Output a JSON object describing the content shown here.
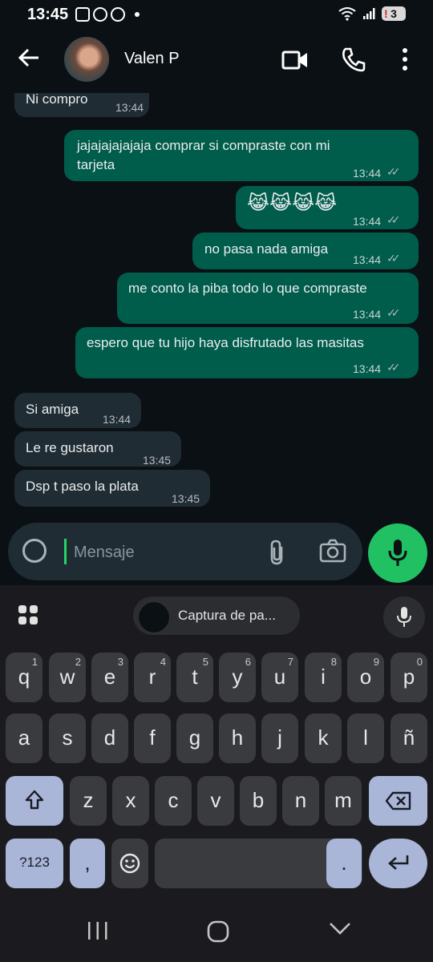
{
  "status_bar": {
    "time": "13:45",
    "notification_count": "3"
  },
  "header": {
    "contact_name": "Valen P"
  },
  "messages": [
    {
      "dir": "in",
      "text": "Ni compro",
      "time": "13:44"
    },
    {
      "dir": "out",
      "lines": [
        "jajajajajajaja comprar si compraste con mi",
        "tarjeta"
      ],
      "time": "13:44"
    },
    {
      "dir": "out",
      "text": "😹😹😹😹",
      "time": "13:44"
    },
    {
      "dir": "out",
      "text": "no pasa nada amiga",
      "time": "13:44"
    },
    {
      "dir": "out",
      "text": "me conto la piba todo lo que compraste",
      "time": "13:44"
    },
    {
      "dir": "out",
      "text": "espero que tu hijo haya disfrutado las masitas",
      "time": "13:44"
    },
    {
      "dir": "in",
      "text": "Si amiga",
      "time": "13:44"
    },
    {
      "dir": "in",
      "text": "Le re gustaron",
      "time": "13:45"
    },
    {
      "dir": "in",
      "text": "Dsp t paso la plata",
      "time": "13:45"
    }
  ],
  "composer": {
    "placeholder": "Mensaje"
  },
  "keyboard": {
    "suggestion_chip": "Captura de pa...",
    "row1": [
      "q",
      "w",
      "e",
      "r",
      "t",
      "y",
      "u",
      "i",
      "o",
      "p"
    ],
    "row1_hints": [
      "1",
      "2",
      "3",
      "4",
      "5",
      "6",
      "7",
      "8",
      "9",
      "0"
    ],
    "row2": [
      "a",
      "s",
      "d",
      "f",
      "g",
      "h",
      "j",
      "k",
      "l",
      "ñ"
    ],
    "row3": [
      "z",
      "x",
      "c",
      "v",
      "b",
      "n",
      "m"
    ],
    "symbols_key": "?123",
    "comma_key": ",",
    "period_key": "."
  },
  "colors": {
    "outgoing_bubble": "#005c4b",
    "incoming_bubble": "#202c33",
    "accent": "#21c063"
  }
}
